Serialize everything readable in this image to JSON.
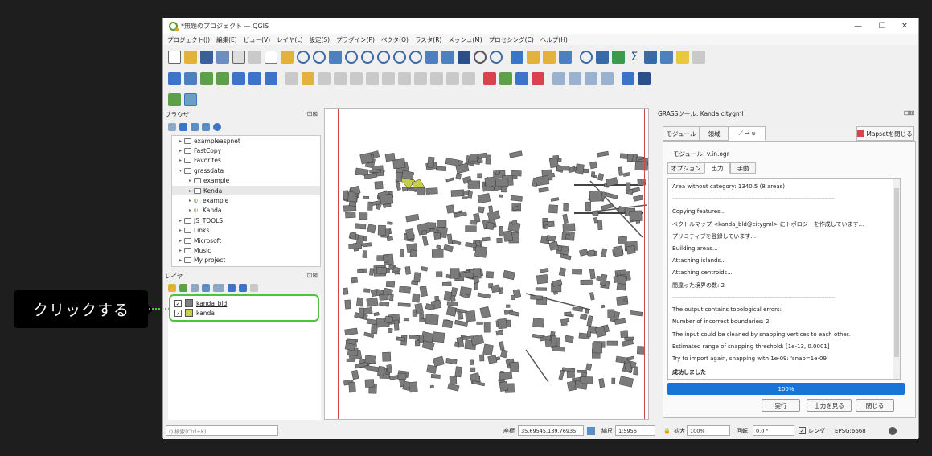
{
  "window": {
    "title": "*無題のプロジェクト — QGIS",
    "controls": [
      "—",
      "☐",
      "✕"
    ]
  },
  "menu": [
    "プロジェクト(J)",
    "編集(E)",
    "ビュー(V)",
    "レイヤ(L)",
    "設定(S)",
    "プラグイン(P)",
    "ベクタ(O)",
    "ラスタ(R)",
    "メッシュ(M)",
    "プロセシング(C)",
    "ヘルプ(H)"
  ],
  "browser": {
    "title": "ブラウザ",
    "dock_icons": "⊡⊠",
    "items": [
      {
        "label": "exampleaspnet",
        "kind": "folder",
        "caret": "▸",
        "depth": 0
      },
      {
        "label": "FastCopy",
        "kind": "folder",
        "caret": "▸",
        "depth": 0
      },
      {
        "label": "Favorites",
        "kind": "folder",
        "caret": "▸",
        "depth": 0
      },
      {
        "label": "grassdata",
        "kind": "folder",
        "caret": "▾",
        "depth": 0
      },
      {
        "label": "example",
        "kind": "folder",
        "caret": "▸",
        "depth": 1
      },
      {
        "label": "Kenda",
        "kind": "folder",
        "caret": "▸",
        "depth": 1
      },
      {
        "label": "example",
        "kind": "grass",
        "caret": "▸",
        "depth": 1
      },
      {
        "label": "Kanda",
        "kind": "grass",
        "caret": "▸",
        "depth": 1
      },
      {
        "label": "JS_TOOLS",
        "kind": "folder",
        "caret": "▸",
        "depth": 0
      },
      {
        "label": "Links",
        "kind": "folder",
        "caret": "▸",
        "depth": 0
      },
      {
        "label": "Microsoft",
        "kind": "folder",
        "caret": "▸",
        "depth": 0
      },
      {
        "label": "Music",
        "kind": "folder",
        "caret": "▸",
        "depth": 0
      },
      {
        "label": "My project",
        "kind": "folder",
        "caret": "▸",
        "depth": 0
      }
    ]
  },
  "layers": {
    "title": "レイヤ",
    "dock_icons": "⊡⊠",
    "items": [
      {
        "label": "kanda_bld",
        "checked": "✓",
        "swatch": "#7f7f7f"
      },
      {
        "label": "kanda",
        "checked": "✓",
        "swatch": "#c6cf4a"
      }
    ]
  },
  "grass": {
    "title": "GRASSツール: Kanda citygml",
    "tabs": [
      "モジュール",
      "領域",
      "⟋ → ⍦"
    ],
    "close_mapset": "Mapsetを閉じる",
    "module_label": "モジュール: v.in.ogr",
    "sub_tabs": [
      "オプション",
      "出力",
      "手動"
    ],
    "output_lines": [
      "Area without category: 1340.5 (8 areas)",
      "--------------------------------------------------------------------------------",
      "Copying features...",
      "ベクトルマップ <kanda_bld@citygml> にトポロジーを作成しています...",
      "プリミティブを登録しています...",
      "Building areas...",
      "Attaching islands...",
      "Attaching centroids...",
      "間違った境界の数: 2",
      "--------------------------------------------------------------------------------",
      "The output contains topological errors:",
      "Number of incorrect boundaries: 2",
      "The input could be cleaned by snapping vertices to each other.",
      "Estimated range of snapping threshold: [1e-13, 0.0001]",
      "Try to import again, snapping with 1e-09: 'snap=1e-09'",
      "成功しました"
    ],
    "progress_text": "100%",
    "progress_value": 1.0,
    "buttons": [
      "実行",
      "出力を見る",
      "閉じる"
    ]
  },
  "status": {
    "search_placeholder": "Q 検索(Ctrl+K)",
    "coord_label": "座標",
    "coord_value": "35.69545,139.76935",
    "scale_label": "縮尺",
    "scale_value": "1:5956",
    "zoom_label": "拡大",
    "zoom_value": "100%",
    "rotation_label": "回転",
    "rotation_value": "0.0 °",
    "render_label": "レンダ",
    "crs": "EPSG:6668"
  },
  "callout": {
    "text": "クリックする"
  },
  "colors": {
    "highlight": "#4fc23e",
    "progress": "#1a73d6",
    "building": "#7b7b7b",
    "road_selected": "#c6cf4a"
  }
}
